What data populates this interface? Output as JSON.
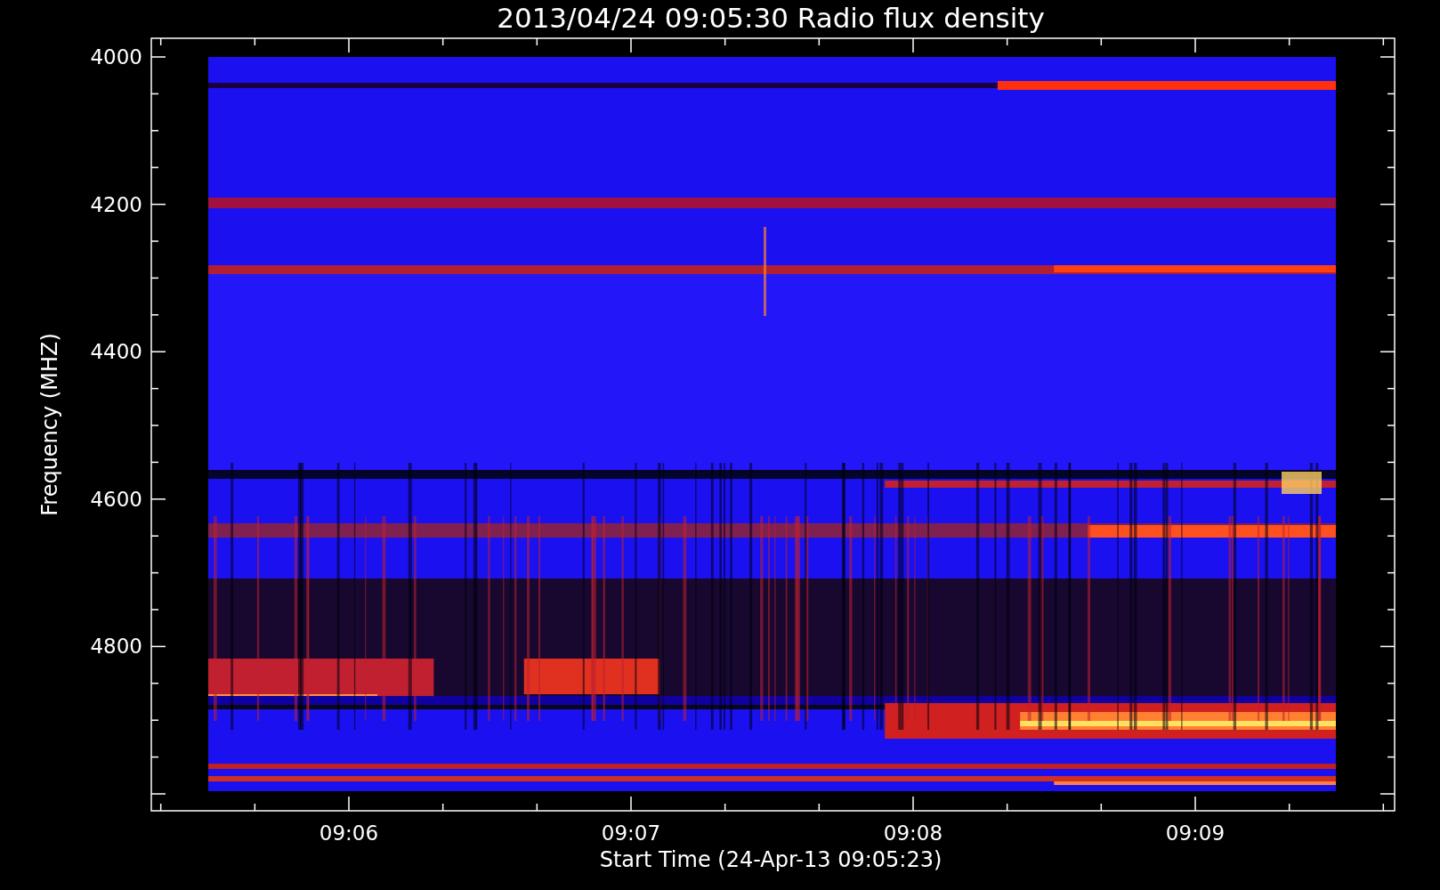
{
  "title": "2013/04/24 09:05:30 Radio flux density",
  "y_axis": {
    "label": "Frequency (MHZ)",
    "ticks": [
      "4000",
      "4200",
      "4400",
      "4600",
      "4800"
    ]
  },
  "x_axis": {
    "label": "Start Time (24-Apr-13 09:05:23)",
    "ticks": [
      "09:06",
      "09:07",
      "09:08",
      "09:09"
    ]
  }
}
